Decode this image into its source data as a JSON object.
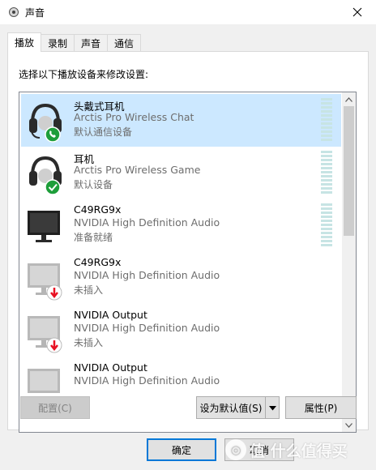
{
  "window": {
    "title": "声音",
    "close_icon": "close-icon",
    "app_icon": "speaker-icon"
  },
  "tabs": [
    {
      "label": "播放",
      "active": true
    },
    {
      "label": "录制",
      "active": false
    },
    {
      "label": "声音",
      "active": false
    },
    {
      "label": "通信",
      "active": false
    }
  ],
  "instruction": "选择以下播放设备来修改设置:",
  "devices": [
    {
      "name": "头戴式耳机",
      "description": "Arctis Pro Wireless Chat",
      "status": "默认通信设备",
      "icon": "headset-icon",
      "badge": "phone-badge",
      "selected": true
    },
    {
      "name": "耳机",
      "description": "Arctis Pro Wireless Game",
      "status": "默认设备",
      "icon": "headset-icon",
      "badge": "check-badge",
      "selected": false
    },
    {
      "name": "C49RG9x",
      "description": "NVIDIA High Definition Audio",
      "status": "准备就绪",
      "icon": "monitor-icon",
      "badge": "",
      "selected": false
    },
    {
      "name": "C49RG9x",
      "description": "NVIDIA High Definition Audio",
      "status": "未插入",
      "icon": "monitor-icon",
      "badge": "unplugged-badge",
      "selected": false
    },
    {
      "name": "NVIDIA Output",
      "description": "NVIDIA High Definition Audio",
      "status": "未插入",
      "icon": "monitor-icon",
      "badge": "unplugged-badge",
      "selected": false
    },
    {
      "name": "NVIDIA Output",
      "description": "NVIDIA High Definition Audio",
      "status": "",
      "icon": "monitor-icon",
      "badge": "unplugged-badge",
      "selected": false
    }
  ],
  "buttons": {
    "configure": "配置(C)",
    "set_default": "设为默认值(S)",
    "properties": "属性(P)",
    "ok": "确定",
    "cancel": "取消"
  },
  "watermark": "值 什么值得买",
  "colors": {
    "selection": "#cce8ff",
    "accent": "#0078d7",
    "check_green": "#1e9e3a",
    "unplugged_red": "#e81123"
  }
}
